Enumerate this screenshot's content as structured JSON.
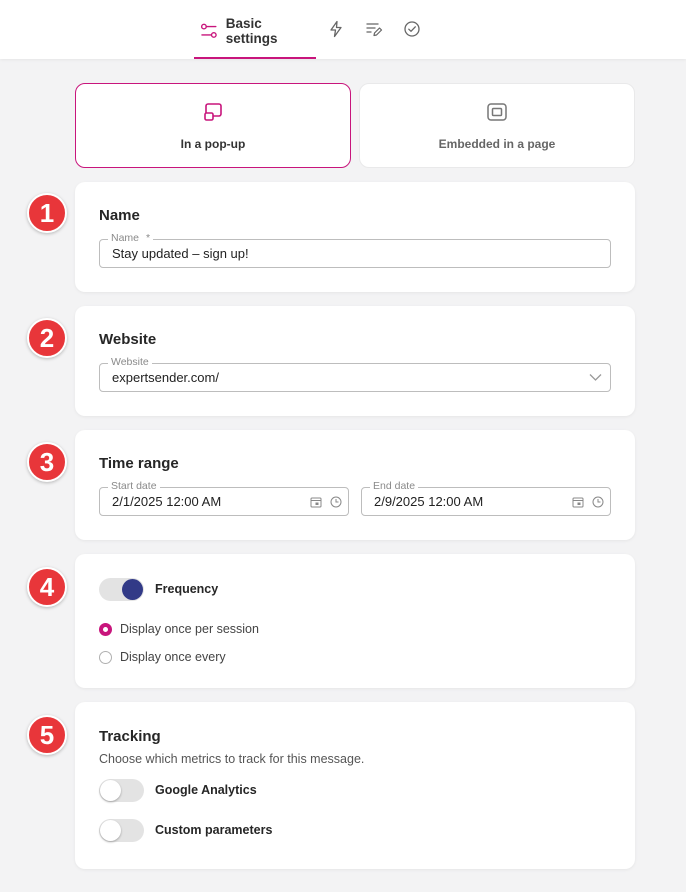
{
  "tabs": {
    "basic_label": "Basic settings",
    "icons": [
      "sliders-icon",
      "lightning-icon",
      "list-edit-icon",
      "check-circle-icon"
    ]
  },
  "modes": {
    "popup_label": "In a pop-up",
    "embedded_label": "Embedded in a page",
    "selected": "In a pop-up"
  },
  "badges": [
    "1",
    "2",
    "3",
    "4",
    "5"
  ],
  "name_section": {
    "title": "Name",
    "field_label": "Name",
    "required_mark": "*",
    "value": "Stay updated – sign up!"
  },
  "website_section": {
    "title": "Website",
    "field_label": "Website",
    "value": "expertsender.com/"
  },
  "time_section": {
    "title": "Time range",
    "start_label": "Start date",
    "start_value": "2/1/2025 12:00 AM",
    "end_label": "End date",
    "end_value": "2/9/2025 12:00 AM"
  },
  "frequency_section": {
    "toggle_label": "Frequency",
    "toggle_on": true,
    "options": [
      "Display once per session",
      "Display once every"
    ],
    "selected_option": "Display once per session"
  },
  "tracking_section": {
    "title": "Tracking",
    "description": "Choose which metrics to track for this message.",
    "google_label": "Google Analytics",
    "custom_label": "Custom parameters",
    "google_on": false,
    "custom_on": false
  },
  "colors": {
    "accent": "#c8157c",
    "toggle_on": "#323a87",
    "badge": "#e8363a",
    "background": "#f3f3f4"
  }
}
